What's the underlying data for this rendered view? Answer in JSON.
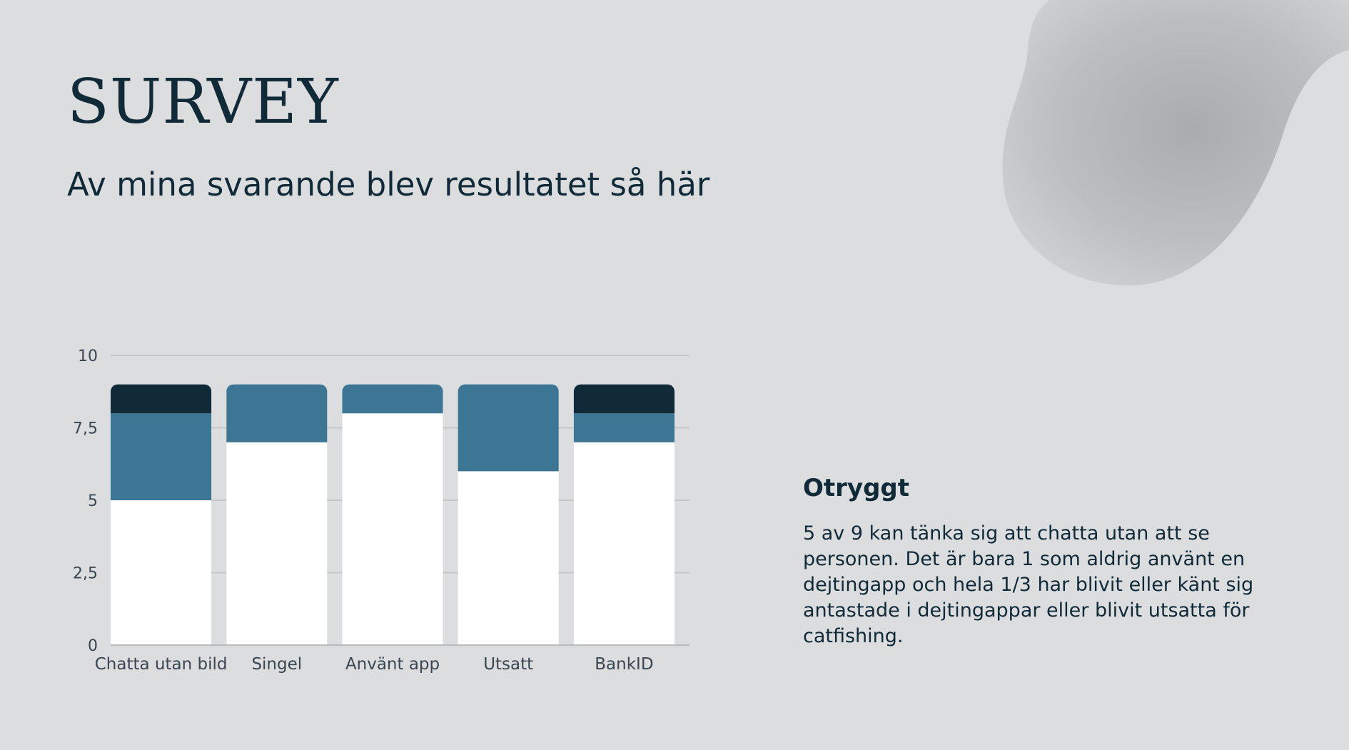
{
  "slide": {
    "title": "SURVEY",
    "subtitle": "Av mina svarande blev resultatet så här"
  },
  "side": {
    "heading": "Otryggt",
    "body": "5 av 9 kan tänka sig att chatta utan att se personen. Det är bara 1 som aldrig använt en dejtingapp och hela 1/3 har blivit eller känt sig antastade i dejtingappar eller blivit utsatta för catfishing."
  },
  "colors": {
    "background": "#dcdddf",
    "text": "#102a38",
    "series": [
      "#ffffff",
      "#3d7694",
      "#102a38"
    ]
  },
  "chart_data": {
    "type": "bar",
    "stacked": true,
    "categories": [
      "Chatta utan bild",
      "Singel",
      "Använt app",
      "Utsatt",
      "BankID"
    ],
    "series": [
      {
        "values": [
          5,
          7,
          8,
          6,
          7
        ]
      },
      {
        "values": [
          3,
          2,
          1,
          3,
          1
        ]
      },
      {
        "values": [
          1,
          0,
          0,
          0,
          1
        ]
      }
    ],
    "ylim": [
      0,
      10
    ],
    "yticks": [
      0,
      2.5,
      5,
      7.5,
      10
    ],
    "ytick_labels": [
      "0",
      "2,5",
      "5",
      "7,5",
      "10"
    ],
    "grid": true,
    "legend": "none"
  }
}
